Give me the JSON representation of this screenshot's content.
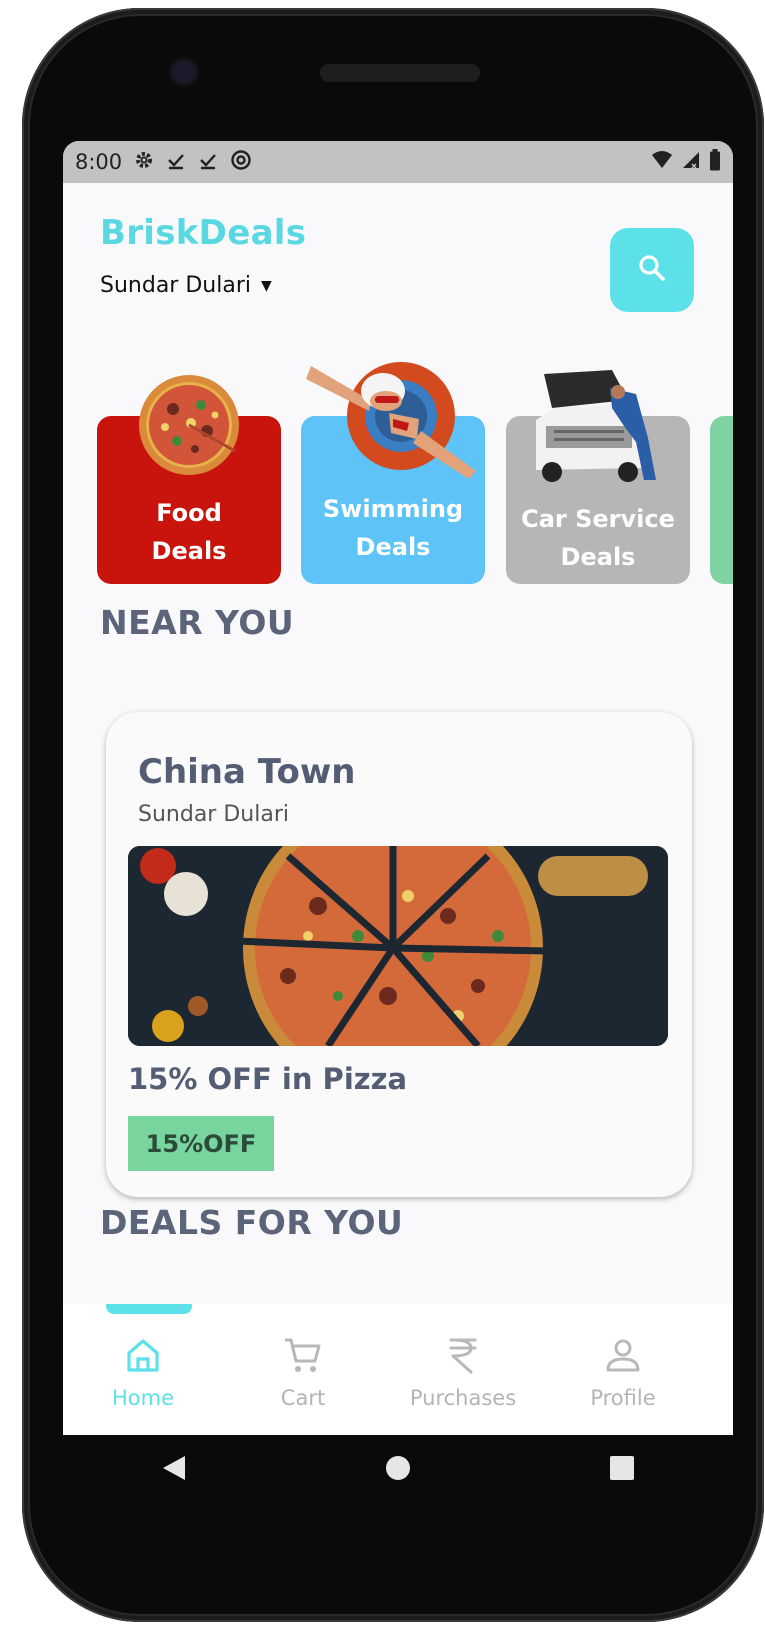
{
  "status_bar": {
    "time": "8:00",
    "left_icons": [
      "gear-icon",
      "download-check-icon",
      "download-check-icon",
      "at-sign-icon"
    ],
    "right_icons": [
      "wifi-icon",
      "signal-icon",
      "battery-icon"
    ]
  },
  "header": {
    "brand": "BriskDeals",
    "location": "Sundar Dulari",
    "brand_color": "#5ad8e2",
    "accent_color": "#5de1e8"
  },
  "categories": [
    {
      "label_line1": "Food",
      "label_line2": "Deals",
      "color": "#c8140c"
    },
    {
      "label_line1": "Swimming",
      "label_line2": "Deals",
      "color": "#5ec3f6"
    },
    {
      "label_line1": "Car Service",
      "label_line2": "Deals",
      "color": "#b6b6b6"
    },
    {
      "label_line1": "",
      "label_line2": "",
      "color": "#7fd2a1"
    }
  ],
  "sections": {
    "near_you": "NEAR YOU",
    "deals_for_you": "DEALS FOR YOU"
  },
  "deal_card": {
    "title": "China Town",
    "subtitle": "Sundar Dulari",
    "deal_text": "15% OFF in Pizza",
    "badge": "15%OFF",
    "badge_color": "#79d59e"
  },
  "bottom_nav": {
    "items": [
      {
        "label": "Home",
        "icon": "home-icon",
        "active": true
      },
      {
        "label": "Cart",
        "icon": "cart-icon",
        "active": false
      },
      {
        "label": "Purchases",
        "icon": "rupee-icon",
        "active": false
      },
      {
        "label": "Profile",
        "icon": "profile-icon",
        "active": false
      }
    ]
  },
  "android_nav": [
    "back-icon",
    "home-circle-icon",
    "recents-icon"
  ]
}
